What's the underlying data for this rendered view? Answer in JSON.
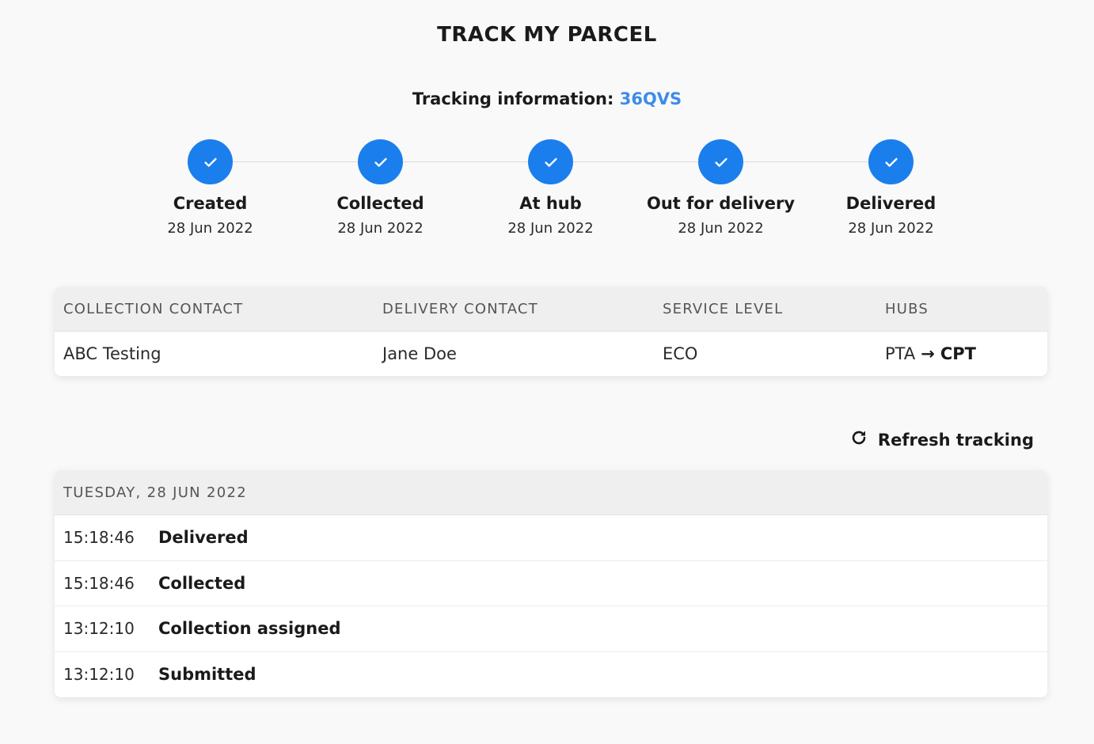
{
  "page": {
    "title": "TRACK MY PARCEL"
  },
  "tracking": {
    "label": "Tracking information:",
    "code": "36QVS"
  },
  "colors": {
    "accent": "#1a7fed",
    "tracking_code": "#3d8be9"
  },
  "steps": [
    {
      "label": "Created",
      "date": "28 Jun 2022",
      "icon": "check-icon",
      "completed": true
    },
    {
      "label": "Collected",
      "date": "28 Jun 2022",
      "icon": "check-icon",
      "completed": true
    },
    {
      "label": "At hub",
      "date": "28 Jun 2022",
      "icon": "check-icon",
      "completed": true
    },
    {
      "label": "Out for delivery",
      "date": "28 Jun 2022",
      "icon": "check-icon",
      "completed": true
    },
    {
      "label": "Delivered",
      "date": "28 Jun 2022",
      "icon": "check-icon",
      "completed": true
    }
  ],
  "info": {
    "headers": [
      "COLLECTION CONTACT",
      "DELIVERY CONTACT",
      "SERVICE LEVEL",
      "HUBS"
    ],
    "collection_contact": "ABC Testing",
    "delivery_contact": "Jane Doe",
    "service_level": "ECO",
    "hubs": {
      "from": "PTA",
      "arrow": "→",
      "to": "CPT"
    }
  },
  "refresh": {
    "label": "Refresh tracking",
    "icon": "refresh-icon"
  },
  "events": {
    "date_header": "TUESDAY, 28 JUN 2022",
    "rows": [
      {
        "time": "15:18:46",
        "status": "Delivered"
      },
      {
        "time": "15:18:46",
        "status": "Collected"
      },
      {
        "time": "13:12:10",
        "status": "Collection assigned"
      },
      {
        "time": "13:12:10",
        "status": "Submitted"
      }
    ]
  }
}
